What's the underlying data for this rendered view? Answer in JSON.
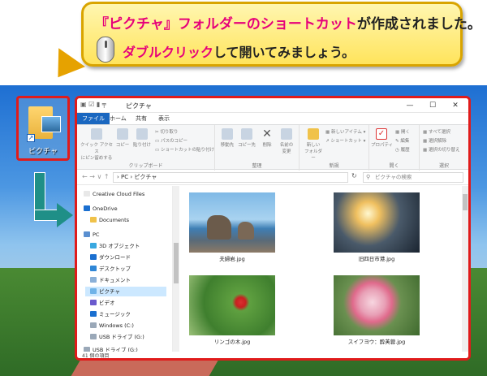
{
  "callout": {
    "line1_a": "『",
    "line1_b": "ピクチャ",
    "line1_c": "』フォルダーの",
    "line1_d": "ショートカット",
    "line1_e": "が作成されました。",
    "line2_a": "ダブルクリック",
    "line2_b": "して開いてみましょう。"
  },
  "desktop": {
    "icon_label": "ピクチャ"
  },
  "window": {
    "title": "ピクチャ",
    "controls": {
      "min": "—",
      "max": "☐",
      "close": "✕"
    },
    "tabs": [
      "ファイル",
      "ホーム",
      "共有",
      "表示"
    ],
    "ribbon": {
      "clipboard": {
        "label": "クリップボード",
        "pin": "クイック アクセス\nにピン留めする",
        "copy": "コピー",
        "paste": "貼り付け",
        "cut": "切り取り",
        "copy_path": "パスのコピー",
        "paste_shortcut": "ショートカットの貼り付け"
      },
      "organize": {
        "label": "整理",
        "move": "移動先",
        "copy_to": "コピー先",
        "delete": "削除",
        "rename": "名前の\n変更"
      },
      "new": {
        "label": "新規",
        "folder": "新しい\nフォルダー",
        "new_item": "新しいアイテム",
        "shortcut": "ショートカット"
      },
      "open": {
        "label": "開く",
        "properties": "プロパティ",
        "open": "開く",
        "edit": "編集",
        "history": "履歴"
      },
      "select": {
        "label": "選択",
        "select_all": "すべて選択",
        "select_none": "選択解除",
        "invert": "選択の切り替え"
      }
    },
    "address": {
      "path": "› PC › ピクチャ",
      "search_placeholder": "ピクチャの検索"
    },
    "nav": [
      "Creative Cloud Files",
      "OneDrive",
      "Documents",
      "PC",
      "3D オブジェクト",
      "ダウンロード",
      "デスクトップ",
      "ドキュメント",
      "ピクチャ",
      "ビデオ",
      "ミュージック",
      "Windows (C:)",
      "USB ドライブ (G:)",
      "USB ドライブ (G:)"
    ],
    "files": [
      "夫婦岩.jpg",
      "旧四日市港.jpg",
      "リンゴの木.jpg",
      "スイフヨウ：酔芙蓉.jpg"
    ],
    "status": "41 個の項目"
  }
}
